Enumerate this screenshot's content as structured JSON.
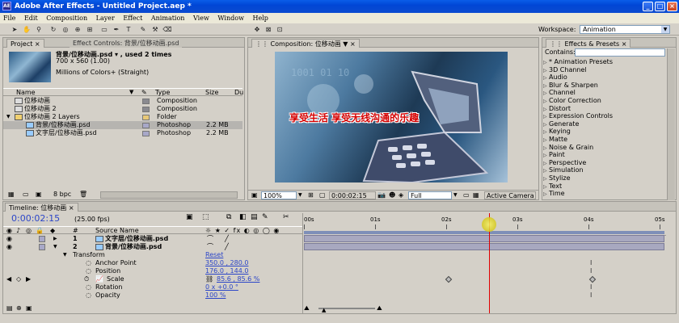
{
  "window": {
    "title": "Adobe After Effects - Untitled Project.aep *",
    "app_icon": "AE"
  },
  "menu": [
    "File",
    "Edit",
    "Composition",
    "Layer",
    "Effect",
    "Animation",
    "View",
    "Window",
    "Help"
  ],
  "workspace": {
    "label": "Workspace:",
    "value": "Animation"
  },
  "project_panel": {
    "tabs": [
      "Project",
      "Effect Controls: 背景/位移动画.psd"
    ],
    "selected_item": {
      "name": "背景/位移动画.psd ▾ , used 2 times",
      "dimensions": "700 x 560 (1.00)",
      "colors": "Millions of Colors+ (Straight)"
    },
    "columns": [
      "Name",
      "Type",
      "Size",
      "Du"
    ],
    "items": [
      {
        "name": "位移动画",
        "type": "Composition",
        "size": "",
        "swatch": "#8a8a90",
        "indent": 0
      },
      {
        "name": "位移动画 2",
        "type": "Composition",
        "size": "",
        "swatch": "#8a8a90",
        "indent": 0
      },
      {
        "name": "位移动画 2 Layers",
        "type": "Folder",
        "size": "",
        "swatch": "#e8c878",
        "indent": 0
      },
      {
        "name": "背景/位移动画.psd",
        "type": "Photoshop",
        "size": "2.2 MB",
        "swatch": "#a8a8c8",
        "indent": 1
      },
      {
        "name": "文字层/位移动画.psd",
        "type": "Photoshop",
        "size": "2.2 MB",
        "swatch": "#a8a8c8",
        "indent": 1
      }
    ],
    "bit_depth": "8 bpc"
  },
  "composition_panel": {
    "tab": "Composition: 位移动画",
    "overlay_text": "享受生活  享受无线沟通的乐趣",
    "zoom": "100%",
    "timecode": "0:00:02:15",
    "resolution": "Full",
    "camera": "Active Camera"
  },
  "effects_panel": {
    "tab": "Effects & Presets",
    "contains_label": "Contains:",
    "items": [
      "* Animation Presets",
      "3D Channel",
      "Audio",
      "Blur & Sharpen",
      "Channel",
      "Color Correction",
      "Distort",
      "Expression Controls",
      "Generate",
      "Keying",
      "Matte",
      "Noise & Grain",
      "Paint",
      "Perspective",
      "Simulation",
      "Stylize",
      "Text",
      "Time"
    ]
  },
  "timeline": {
    "tab": "Timeline: 位移动画",
    "current_time": "0:00:02:15",
    "fps": "(25.00 fps)",
    "source_name_header": "Source Name",
    "ruler": [
      "00s",
      "01s",
      "02s",
      "03s",
      "04s",
      "05s"
    ],
    "layers": [
      {
        "index": "1",
        "name": "文字层/位移动画.psd"
      },
      {
        "index": "2",
        "name": "背景/位移动画.psd"
      }
    ],
    "transform": {
      "label": "Transform",
      "reset": "Reset",
      "properties": [
        {
          "name": "Anchor Point",
          "value": "350.0 , 280.0"
        },
        {
          "name": "Position",
          "value": "176.0 , 144.0"
        },
        {
          "name": "Scale",
          "value": "85.6 , 85.6 %"
        },
        {
          "name": "Rotation",
          "value": "0 x +0.0 °"
        },
        {
          "name": "Opacity",
          "value": "100 %"
        }
      ]
    },
    "playhead_seconds": 2.6
  }
}
